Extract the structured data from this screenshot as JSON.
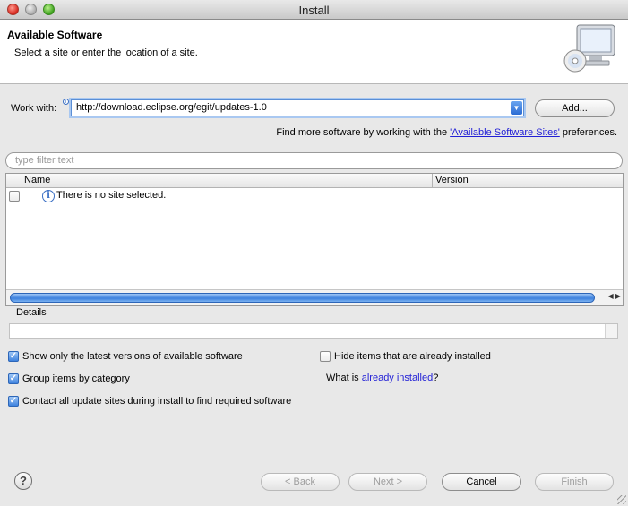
{
  "window": {
    "title": "Install"
  },
  "header": {
    "title": "Available Software",
    "description": "Select a site or enter the location of a site.",
    "icon": "monitor-with-cd-icon"
  },
  "work_with": {
    "label": "Work with:",
    "value": "http://download.eclipse.org/egit/updates-1.0",
    "add_button": "Add..."
  },
  "find_more": {
    "prefix": "Find more software by working with the ",
    "link": "'Available Software Sites'",
    "suffix": " preferences."
  },
  "filter": {
    "placeholder": "type filter text"
  },
  "table": {
    "columns": [
      "Name",
      "Version"
    ],
    "rows": [
      {
        "checked": false,
        "icon": "info-icon",
        "name": "There is no site selected."
      }
    ]
  },
  "details": {
    "label": "Details"
  },
  "options": {
    "show_latest": {
      "label": "Show only the latest versions of available software",
      "checked": true
    },
    "group_by_category": {
      "label": "Group items by category",
      "checked": true
    },
    "contact_all_sites": {
      "label": "Contact all update sites during install to find required software",
      "checked": true
    },
    "hide_installed": {
      "label": "Hide items that are already installed",
      "checked": false
    },
    "what_is": {
      "prefix": "What is ",
      "link": "already installed",
      "suffix": "?"
    }
  },
  "buttons": {
    "back": "< Back",
    "next": "Next >",
    "cancel": "Cancel",
    "finish": "Finish",
    "help": "?"
  },
  "colors": {
    "link": "#2220d6",
    "accent": "#3e82de"
  }
}
